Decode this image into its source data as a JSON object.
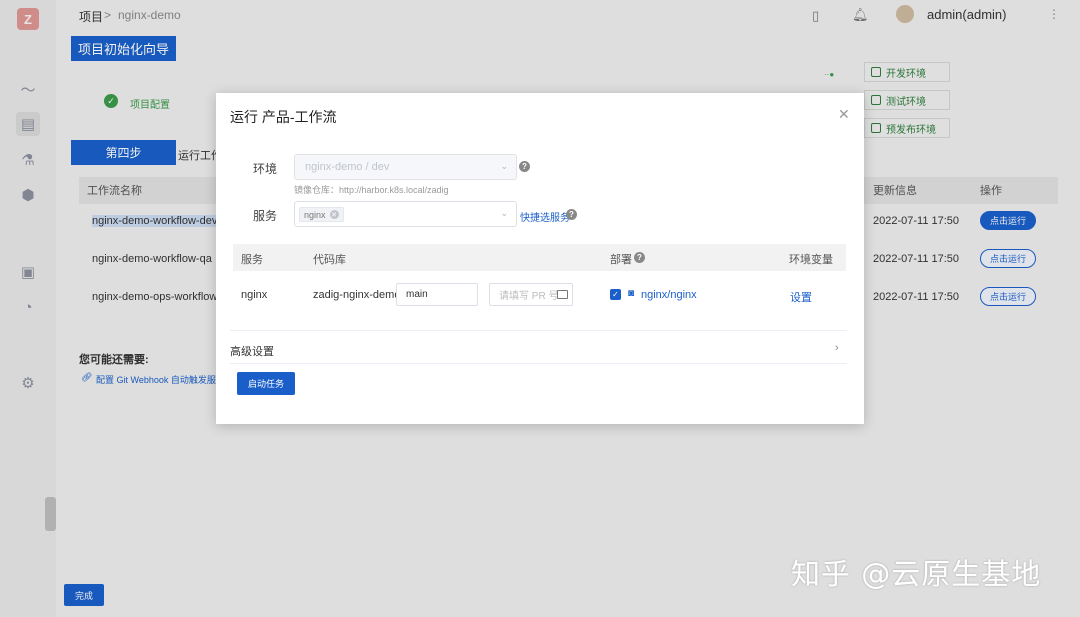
{
  "breadcrumb": {
    "root": "项目",
    "project": "nginx-demo"
  },
  "header": {
    "user": "admin(admin)"
  },
  "wizard": {
    "title": "项目初始化向导",
    "step_done": "项目配置",
    "step_current": "第四步",
    "step_desc": "运行工作",
    "env_buttons": [
      "开发环境",
      "测试环境",
      "预发布环境"
    ]
  },
  "workflow_table": {
    "headers": {
      "name": "工作流名称",
      "updated": "更新信息",
      "action": "操作"
    },
    "rows": [
      {
        "name": "nginx-demo-workflow-dev",
        "updated": "2022-07-11 17:50",
        "action": "点击运行"
      },
      {
        "name": "nginx-demo-workflow-qa",
        "updated": "2022-07-11 17:50",
        "action": "点击运行"
      },
      {
        "name": "nginx-demo-ops-workflow",
        "updated": "2022-07-11 17:50",
        "action": "点击运行"
      }
    ]
  },
  "suggest": {
    "title": "您可能还需要:",
    "link": "配置 Git Webhook 自动触发服务"
  },
  "finish_button": "完成",
  "modal": {
    "title": "运行 产品-工作流",
    "env_label": "环境",
    "env_value": "nginx-demo / dev",
    "registry_hint": "镜像仓库：http://harbor.k8s.local/zadig",
    "service_label": "服务",
    "service_tag": "nginx",
    "quick_select": "快捷选服务",
    "table": {
      "headers": {
        "service": "服务",
        "repo": "代码库",
        "deploy": "部署",
        "env_vars": "环境变量"
      },
      "row": {
        "service": "nginx",
        "repo": "zadig-nginx-demo",
        "branch": "main",
        "pr_placeholder": "请填写 PR 号",
        "deploy": "nginx/nginx",
        "env_vars": "设置"
      }
    },
    "advanced": "高级设置",
    "start_button": "启动任务"
  },
  "watermark": "知乎 @云原生基地"
}
